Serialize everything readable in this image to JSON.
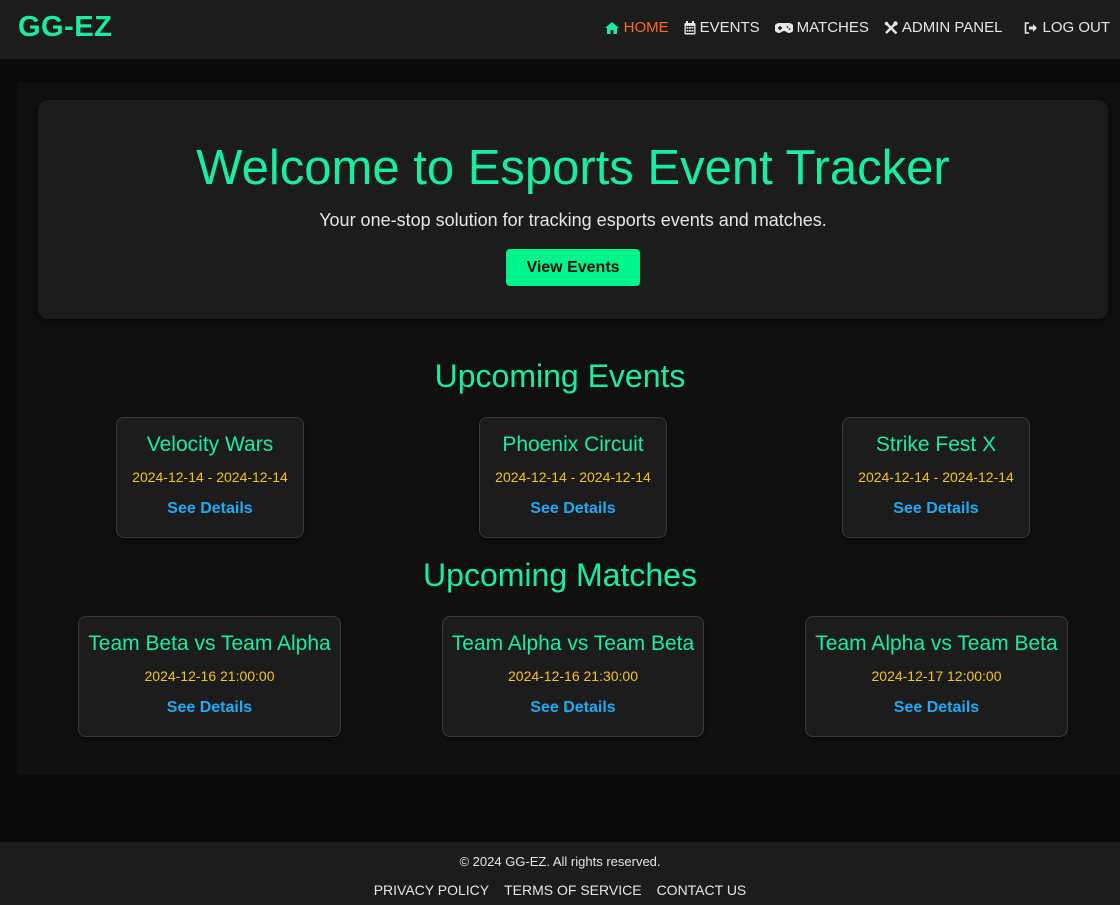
{
  "brand": "GG-EZ",
  "nav": {
    "home": "HOME",
    "events": "EVENTS",
    "matches": "MATCHES",
    "admin": "ADMIN PANEL",
    "logout": "LOG OUT",
    "icons": [
      "home-icon",
      "calendar-icon",
      "gamepad-icon",
      "tools-icon",
      "sign-out-icon"
    ],
    "active_color": "#ff6a1f"
  },
  "hero": {
    "title": "Welcome to Esports Event Tracker",
    "subtitle": "Your one-stop solution for tracking esports events and matches.",
    "button": "View Events"
  },
  "events": {
    "heading": "Upcoming Events",
    "items": [
      {
        "name": "Velocity Wars",
        "dates": "2024-12-14 - 2024-12-14",
        "link": "See Details"
      },
      {
        "name": "Phoenix Circuit",
        "dates": "2024-12-14 - 2024-12-14",
        "link": "See Details"
      },
      {
        "name": "Strike Fest X",
        "dates": "2024-12-14 - 2024-12-14",
        "link": "See Details"
      }
    ]
  },
  "matches": {
    "heading": "Upcoming Matches",
    "items": [
      {
        "name": "Team Beta vs Team Alpha",
        "time": "2024-12-16 21:00:00",
        "link": "See Details"
      },
      {
        "name": "Team Alpha vs Team Beta",
        "time": "2024-12-16 21:30:00",
        "link": "See Details"
      },
      {
        "name": "Team Alpha vs Team Beta",
        "time": "2024-12-17 12:00:00",
        "link": "See Details"
      }
    ]
  },
  "footer": {
    "copyright": "© 2024 GG-EZ. All rights reserved.",
    "privacy": "PRIVACY POLICY",
    "terms": "TERMS OF SERVICE",
    "contact": "CONTACT US"
  },
  "colors": {
    "accent": "#17eea0",
    "button": "#00f58a",
    "date": "#f5c518",
    "link": "#1eaaf5"
  }
}
